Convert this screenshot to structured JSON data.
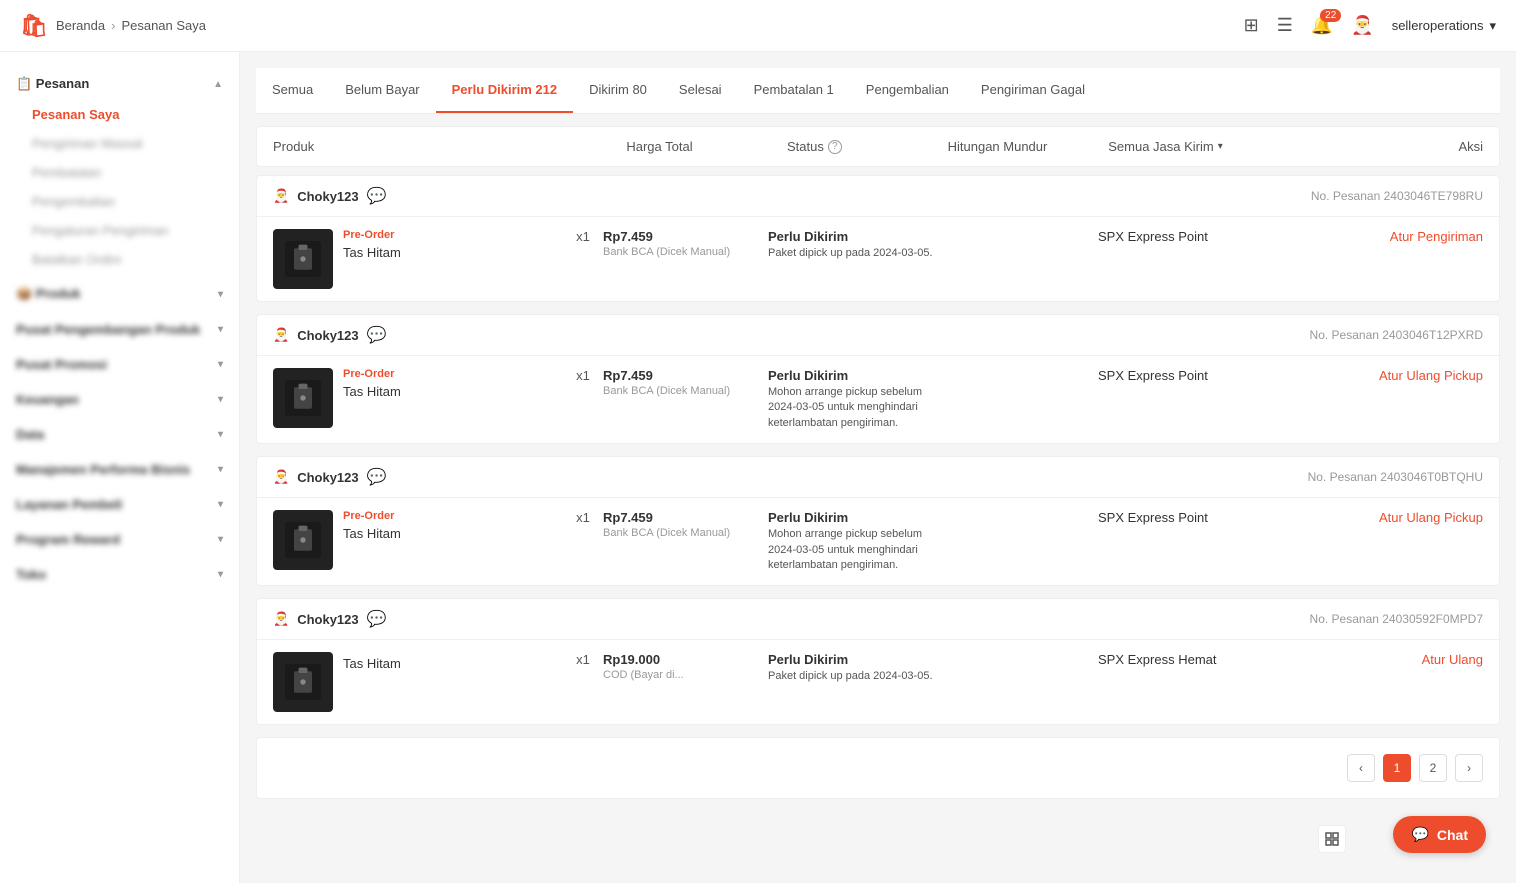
{
  "header": {
    "logo": "S",
    "breadcrumb_home": "Beranda",
    "breadcrumb_current": "Pesanan Saya",
    "user": "selleroperations",
    "notification_count": "22"
  },
  "sidebar": {
    "sections": [
      {
        "label": "Pesanan",
        "items": [
          {
            "label": "Pesanan Saya",
            "active": true
          },
          {
            "label": "Pengiriman Massal",
            "blurred": true
          },
          {
            "label": "Pembatalan",
            "blurred": true
          },
          {
            "label": "Pengembalian",
            "blurred": true
          },
          {
            "label": "Pengaturan Pengiriman",
            "blurred": true
          },
          {
            "label": "Batalkan Ordini",
            "blurred": true
          }
        ]
      },
      {
        "label": "Produk",
        "items": []
      },
      {
        "label": "Pusat Pengembangan Produk",
        "items": []
      },
      {
        "label": "Pusat Promosi",
        "items": []
      },
      {
        "label": "Keuangan",
        "items": []
      },
      {
        "label": "Data",
        "items": []
      },
      {
        "label": "Manajemen Performa Bisnis",
        "items": []
      },
      {
        "label": "Layanan Pembeli",
        "items": []
      },
      {
        "label": "Program Reward",
        "items": []
      },
      {
        "label": "Toko",
        "items": []
      }
    ]
  },
  "tabs": [
    {
      "label": "Semua",
      "active": false
    },
    {
      "label": "Belum Bayar",
      "active": false
    },
    {
      "label": "Perlu Dikirim 212",
      "active": true
    },
    {
      "label": "Dikirim 80",
      "active": false
    },
    {
      "label": "Selesai",
      "active": false
    },
    {
      "label": "Pembatalan 1",
      "active": false
    },
    {
      "label": "Pengembalian",
      "active": false
    },
    {
      "label": "Pengiriman Gagal",
      "active": false
    }
  ],
  "table_header": {
    "product": "Produk",
    "price": "Harga Total",
    "status": "Status",
    "countdown": "Hitungan Mundur",
    "shipping": "Semua Jasa Kirim",
    "action": "Aksi"
  },
  "orders": [
    {
      "user": "Choky123",
      "order_number": "No. Pesanan 2403046TE798RU",
      "items": [
        {
          "badge": "Pre-Order",
          "name": "Tas Hitam",
          "qty": "x1",
          "price": "Rp7.459",
          "payment": "Bank BCA (Dicek Manual)",
          "status_label": "Perlu Dikirim",
          "status_desc": "Paket dipick up pada 2024-03-05.",
          "shipping": "SPX Express Point",
          "action": "Atur Pengiriman"
        }
      ]
    },
    {
      "user": "Choky123",
      "order_number": "No. Pesanan 2403046T12PXRD",
      "items": [
        {
          "badge": "Pre-Order",
          "name": "Tas Hitam",
          "qty": "x1",
          "price": "Rp7.459",
          "payment": "Bank BCA (Dicek Manual)",
          "status_label": "Perlu Dikirim",
          "status_desc": "Mohon arrange pickup sebelum 2024-03-05 untuk menghindari keterlambatan pengiriman.",
          "shipping": "SPX Express Point",
          "action": "Atur Ulang Pickup"
        }
      ]
    },
    {
      "user": "Choky123",
      "order_number": "No. Pesanan 2403046T0BTQHU",
      "items": [
        {
          "badge": "Pre-Order",
          "name": "Tas Hitam",
          "qty": "x1",
          "price": "Rp7.459",
          "payment": "Bank BCA (Dicek Manual)",
          "status_label": "Perlu Dikirim",
          "status_desc": "Mohon arrange pickup sebelum 2024-03-05 untuk menghindari keterlambatan pengiriman.",
          "shipping": "SPX Express Point",
          "action": "Atur Ulang Pickup"
        }
      ]
    },
    {
      "user": "Choky123",
      "order_number": "No. Pesanan 24030592F0MPD7",
      "items": [
        {
          "badge": "",
          "name": "Tas Hitam",
          "qty": "x1",
          "price": "Rp19.000",
          "payment": "COD (Bayar di...",
          "status_label": "Perlu Dikirim",
          "status_desc": "Paket dipick up pada 2024-03-05.",
          "shipping": "SPX Express Hemat",
          "action": "Atur Ulang"
        }
      ]
    }
  ],
  "pagination": {
    "prev": "‹",
    "current": "1",
    "next": "2",
    "next_btn": "›"
  },
  "chat": {
    "label": "Chat"
  }
}
